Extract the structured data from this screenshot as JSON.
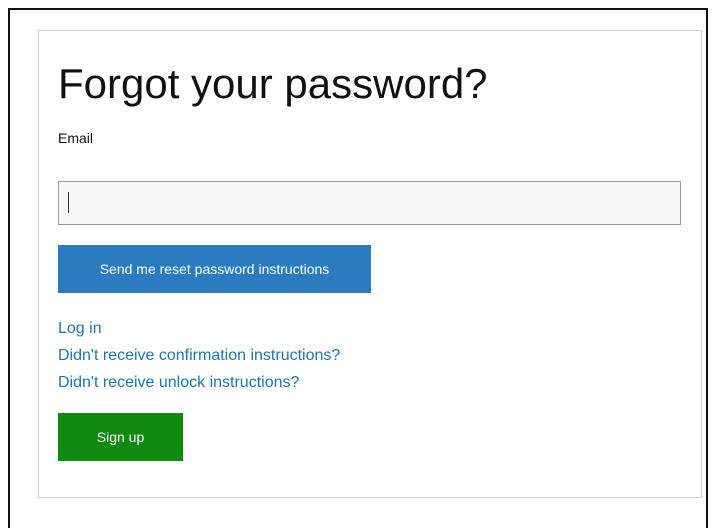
{
  "form": {
    "title": "Forgot your password?",
    "email_label": "Email",
    "email_value": "",
    "reset_button_label": "Send me reset password instructions"
  },
  "links": {
    "login": "Log in",
    "confirmation": "Didn't receive confirmation instructions?",
    "unlock": "Didn't receive unlock instructions?"
  },
  "signup": {
    "label": "Sign up"
  },
  "colors": {
    "primary_button": "#2b7bc1",
    "success_button": "#118a11",
    "link": "#1f73b7"
  }
}
